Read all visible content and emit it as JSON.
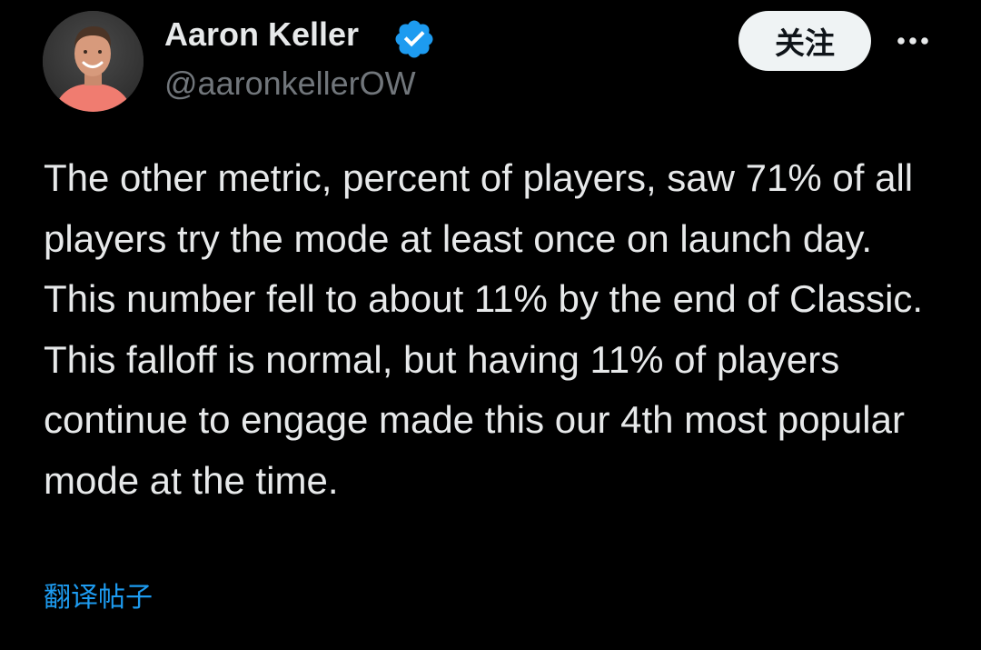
{
  "author": {
    "name": "Aaron Keller",
    "handle": "@aaronkellerOW",
    "verified": true,
    "avatar_icon": "profile-photo"
  },
  "actions": {
    "follow_label": "关注",
    "more_icon": "more-horizontal-icon"
  },
  "post": {
    "text": "The other metric, percent of players, saw 71% of all players try the mode at least once on launch day. This number fell to about 11% by the end of Classic. This falloff is normal, but having 11% of players continue to engage made this our 4th most popular mode at the time.",
    "translate_label": "翻译帖子"
  },
  "colors": {
    "background": "#000000",
    "text_primary": "#e7e9ea",
    "text_secondary": "#71767b",
    "link": "#1d9bf0",
    "verified_badge": "#1d9bf0",
    "follow_button_bg": "#eff3f4"
  }
}
